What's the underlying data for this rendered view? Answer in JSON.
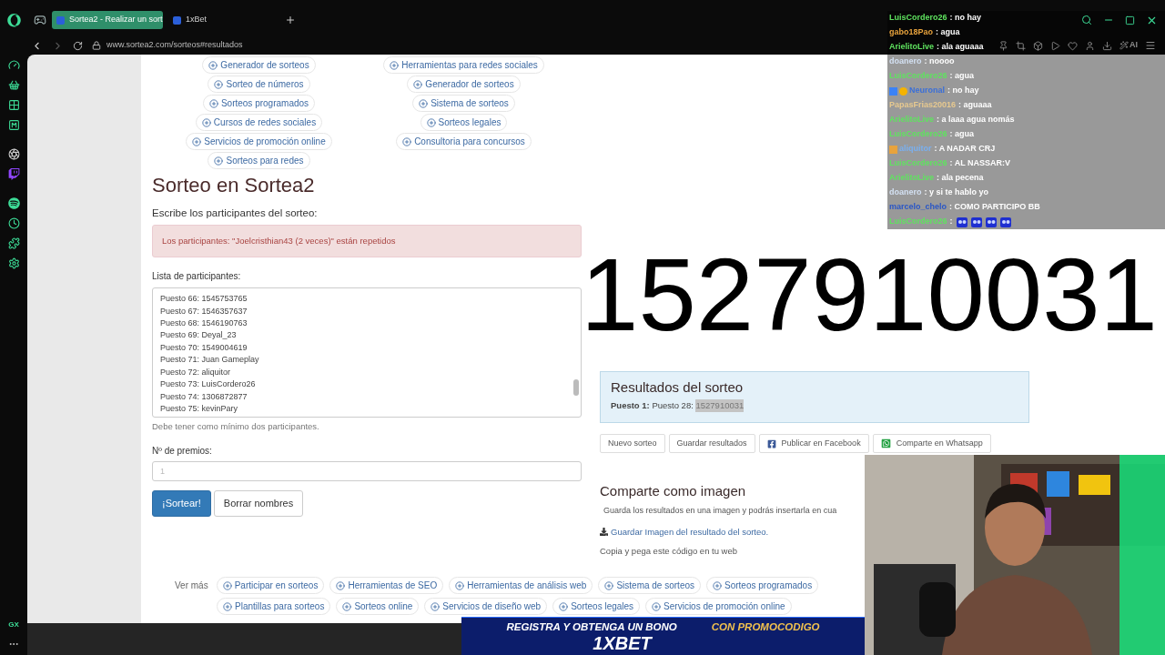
{
  "browser": {
    "tabs": [
      {
        "title": "Sortea2 - Realizar un sort",
        "selected": true
      },
      {
        "title": "1xBet",
        "selected": false
      }
    ],
    "url": "www.sortea2.com/sorteos#resultados",
    "ai_label": "AI",
    "sidebar_label": "GX"
  },
  "page": {
    "nav_columns": [
      {
        "links": [
          "Generador de sorteos",
          "Sorteo de números",
          "Sorteos programados",
          "Cursos de redes sociales",
          "Servicios de promoción online",
          "Sorteos para redes"
        ]
      },
      {
        "links": [
          "Herramientas para redes sociales",
          "Generador de sorteos",
          "Sistema de sorteos",
          "Sorteos legales",
          "Consultoria para concursos"
        ]
      }
    ],
    "title": "Sorteo en Sortea2",
    "prompt": "Escribe los participantes del sorteo:",
    "alert": "Los participantes: \"Joelcristhian43 (2 veces)\" están repetidos",
    "list_label": "Lista de participantes:",
    "participants": [
      "Puesto 66: 1545753765",
      "Puesto 67: 1546357637",
      "Puesto 68: 1546190763",
      "Puesto 69: Deyal_23",
      "Puesto 70: 1549004619",
      "Puesto 71: Juan Gameplay",
      "Puesto 72: aliquitor",
      "Puesto 73: LuisCordero26",
      "Puesto 74: 1306872877",
      "Puesto 75: kevinPary"
    ],
    "help": "Debe tener como mínimo dos participantes.",
    "prizes_label": "Nº de premios:",
    "prizes_placeholder": "1",
    "buttons": [
      {
        "label": "¡Sortear!",
        "kind": "primary"
      },
      {
        "label": "Borrar nombres",
        "kind": "default"
      }
    ],
    "results": {
      "title": "Resultados del sorteo",
      "winner": "**Puesto 1:** Puesto 28: ",
      "value": "1527910031",
      "value_selected": true
    },
    "actions": [
      {
        "label": "Nuevo sorteo",
        "kind": "plain"
      },
      {
        "label": "Guardar resultados",
        "kind": "plain"
      },
      {
        "label": "Publicar en Facebook",
        "kind": "facebook"
      },
      {
        "label": "Comparte en Whatsapp",
        "kind": "whatsapp"
      }
    ],
    "share": {
      "title": "Comparte como imagen",
      "text": "Guarda los resultados en una imagen y podrás insertarla en cua",
      "link": "Guardar Imagen del resultado del sorteo.",
      "code_label": "Copia y pega este código en tu web"
    },
    "more": {
      "label": "Ver más",
      "rows": [
        [
          "Participar en sorteos",
          "Herramientas de SEO",
          "Herramientas de análisis web",
          "Sistema de sorteos",
          "Sorteos programados"
        ],
        [
          "Plantillas para sorteos",
          "Sorteos online",
          "Servicios de diseño web",
          "Sorteos legales",
          "Servicios de promoción online"
        ]
      ]
    }
  },
  "overlay": {
    "winner_number": "1527910031",
    "chat": [
      {
        "user": "LuisCordero26",
        "color": "#5fe35f",
        "text": ": no hay"
      },
      {
        "user": "gabo18Pao",
        "color": "#e8a33d",
        "text": ": agua"
      },
      {
        "user": "ArielitoLive",
        "color": "#5fe35f",
        "text": ": ala aguaaa"
      },
      {
        "user": "doanero",
        "color": "#d3e0f2",
        "text": ": noooo"
      },
      {
        "user": "LuisCordero26",
        "color": "#5fe35f",
        "text": ": agua"
      },
      {
        "user": "Neuronal",
        "color": "#3b6fd8",
        "text": ": no hay",
        "badges": [
          {
            "kind": "prime"
          },
          {
            "kind": "coin"
          }
        ]
      },
      {
        "user": "PapasFrias20016",
        "color": "#e7c98f",
        "text": ": aguaaa"
      },
      {
        "user": "ArielitoLive",
        "color": "#5fe35f",
        "text": ": a laaa agua nomás"
      },
      {
        "user": "LuisCordero26",
        "color": "#5fe35f",
        "text": ": agua"
      },
      {
        "user": "aliquitor",
        "color": "#7ab0f0",
        "text": ": A NADAR CRJ",
        "badges": [
          {
            "kind": "sub"
          }
        ]
      },
      {
        "user": "LuisCordero26",
        "color": "#5fe35f",
        "text": ": AL NASSAR:V"
      },
      {
        "user": "ArielitoLive",
        "color": "#5fe35f",
        "text": ": ala pecena"
      },
      {
        "user": "doanero",
        "color": "#d3e0f2",
        "text": ": y si te hablo yo"
      },
      {
        "user": "marcelo_chelo",
        "color": "#2a56c6",
        "text": ": COMO PARTICIPO BB"
      },
      {
        "user": "LuisCordero26",
        "color": "#5fe35f",
        "text": ":",
        "emotes": [
          {
            "kind": "face"
          },
          {
            "kind": "face"
          },
          {
            "kind": "face"
          },
          {
            "kind": "face"
          }
        ]
      }
    ],
    "ad": {
      "headline": "REGISTRA Y OBTENGA UN BONO",
      "brand": "1XBET",
      "promo": "CON PROMOCODIGO"
    }
  }
}
